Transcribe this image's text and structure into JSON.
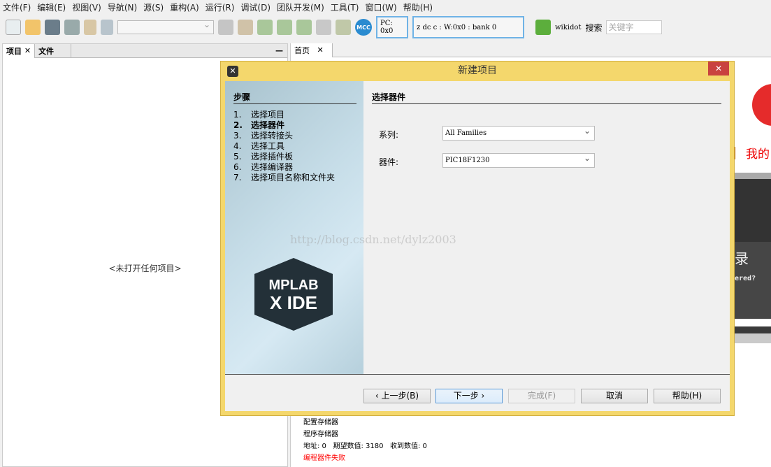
{
  "menu": [
    "文件(F)",
    "编辑(E)",
    "视图(V)",
    "导航(N)",
    "源(S)",
    "重构(A)",
    "运行(R)",
    "调试(D)",
    "团队开发(M)",
    "工具(T)",
    "窗口(W)",
    "帮助(H)"
  ],
  "toolbar": {
    "mcc": "MCC",
    "pc": "PC: 0x0",
    "status": "z dc c  : W:0x0 : bank 0",
    "wikidot": "wikidot",
    "search_label": "搜索",
    "search_placeholder": "关键字"
  },
  "left_panel": {
    "tabs": [
      "项目",
      "文件"
    ],
    "close": "✕",
    "minimize": "—",
    "empty": "<未打开任何项目>"
  },
  "right_panel": {
    "tab": "首页",
    "close": "✕",
    "start_page": {
      "my_text": "我的",
      "login_fragment": "录",
      "registered_fragment": "ered?"
    }
  },
  "dialog": {
    "title": "新建项目",
    "close": "✕",
    "steps_title": "步骤",
    "steps": [
      {
        "n": "1.",
        "label": "选择项目"
      },
      {
        "n": "2.",
        "label": "选择器件"
      },
      {
        "n": "3.",
        "label": "选择转接头"
      },
      {
        "n": "4.",
        "label": "选择工具"
      },
      {
        "n": "5.",
        "label": "选择插件板"
      },
      {
        "n": "6.",
        "label": "选择编译器"
      },
      {
        "n": "7.",
        "label": "选择项目名称和文件夹"
      }
    ],
    "current_step": 2,
    "section_title": "选择器件",
    "family_label": "系列:",
    "family_value": "All Families",
    "device_label": "器件:",
    "device_value": "PIC18F1230",
    "logo": "MPLAB X IDE",
    "buttons": {
      "back": "‹ 上一步(B)",
      "next": "下一步 ›",
      "finish": "完成(F)",
      "cancel": "取消",
      "help": "帮助(H)"
    }
  },
  "watermark": "http://blog.csdn.net/dylz2003",
  "output": [
    "配置存储器",
    "程序存储器",
    "地址: 0   期望数值: 3180   收到数值: 0",
    "编程器件失败"
  ],
  "colors": {
    "dialog_border": "#f4d76c",
    "error": "#ff0000",
    "close": "#c9423f"
  }
}
